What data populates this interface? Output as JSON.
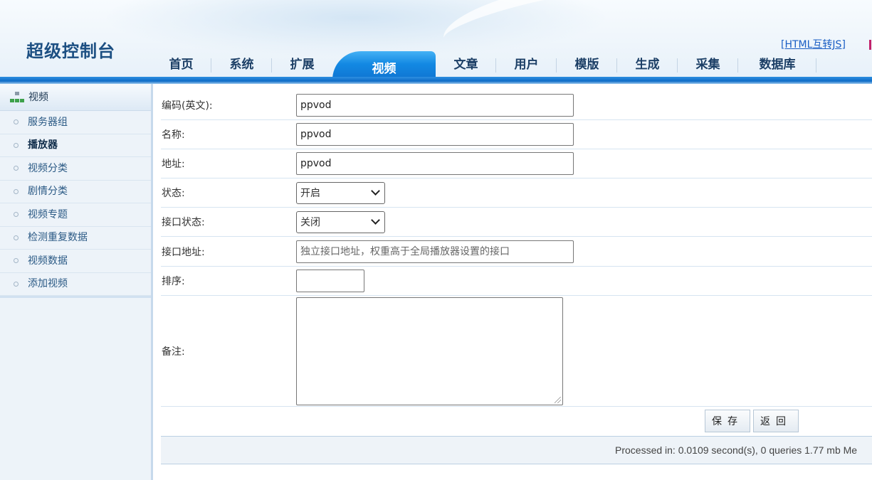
{
  "header": {
    "brand": "超级控制台",
    "top_link": "HTML互转JS",
    "nav": [
      {
        "label": "首页",
        "active": false
      },
      {
        "label": "系统",
        "active": false
      },
      {
        "label": "扩展",
        "active": false
      },
      {
        "label": "视频",
        "active": true
      },
      {
        "label": "文章",
        "active": false
      },
      {
        "label": "用户",
        "active": false
      },
      {
        "label": "模版",
        "active": false
      },
      {
        "label": "生成",
        "active": false
      },
      {
        "label": "采集",
        "active": false
      },
      {
        "label": "数据库",
        "active": false
      }
    ]
  },
  "sidebar": {
    "title": "视频",
    "title_icon": "tree-icon",
    "items": [
      {
        "label": "服务器组",
        "active": false
      },
      {
        "label": "播放器",
        "active": true
      },
      {
        "label": "视频分类",
        "active": false
      },
      {
        "label": "剧情分类",
        "active": false
      },
      {
        "label": "视频专题",
        "active": false
      },
      {
        "label": "检测重复数据",
        "active": false
      },
      {
        "label": "视频数据",
        "active": false
      },
      {
        "label": "添加视频",
        "active": false
      }
    ]
  },
  "form": {
    "code": {
      "label": "编码(英文):",
      "value": "ppvod"
    },
    "name": {
      "label": "名称:",
      "value": "ppvod"
    },
    "address": {
      "label": "地址:",
      "value": "ppvod"
    },
    "status": {
      "label": "状态:",
      "value": "开启"
    },
    "api_status": {
      "label": "接口状态:",
      "value": "关闭"
    },
    "api_address": {
      "label": "接口地址:",
      "value": "",
      "placeholder": "独立接口地址，权重高于全局播放器设置的接口"
    },
    "sort": {
      "label": "排序:",
      "value": ""
    },
    "remark": {
      "label": "备注:",
      "value": ""
    }
  },
  "buttons": {
    "save": "保存",
    "back": "返回"
  },
  "footer": {
    "text": "Processed in: 0.0109 second(s), 0 queries 1.77 mb Me"
  },
  "colors": {
    "brand": "#1c4f82",
    "nav_active": "#1389e3",
    "sidebar_bg": "#edf3f9"
  }
}
